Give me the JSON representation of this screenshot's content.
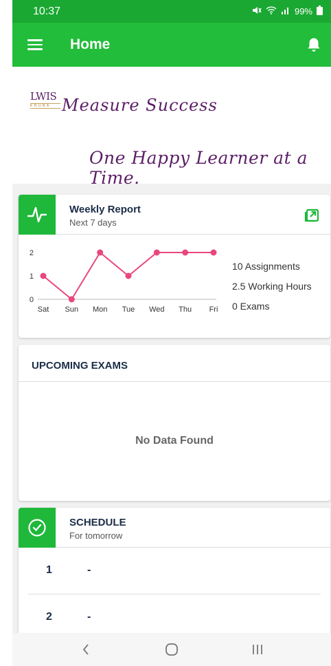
{
  "status_bar": {
    "time": "10:37",
    "battery": "99%"
  },
  "app_bar": {
    "title": "Home"
  },
  "banner": {
    "logo_text": "LWIS",
    "logo_sub": "KRUBA",
    "line1": "Measure Success",
    "line2": "One Happy Learner at a Time."
  },
  "weekly_report": {
    "title": "Weekly Report",
    "subtitle": "Next 7 days",
    "stats": [
      "10  Assignments",
      "2.5  Working Hours",
      "0  Exams"
    ]
  },
  "chart_data": {
    "type": "line",
    "categories": [
      "Sat",
      "Sun",
      "Mon",
      "Tue",
      "Wed",
      "Thu",
      "Fri"
    ],
    "values": [
      1,
      0,
      2,
      1,
      2,
      2,
      2
    ],
    "ylim": [
      0,
      2
    ],
    "yticks": [
      "0",
      "1",
      "2"
    ],
    "grid": false,
    "color": "#e8487c"
  },
  "upcoming_exams": {
    "title": "UPCOMING EXAMS",
    "empty_text": "No Data Found"
  },
  "schedule": {
    "title": "SCHEDULE",
    "subtitle": "For tomorrow",
    "rows": [
      {
        "num": "1",
        "value": "-"
      },
      {
        "num": "2",
        "value": "-"
      }
    ]
  },
  "colors": {
    "primary": "#22bd3a",
    "status": "#1aa832",
    "accent": "#e8487c",
    "heading": "#1b2c47"
  }
}
